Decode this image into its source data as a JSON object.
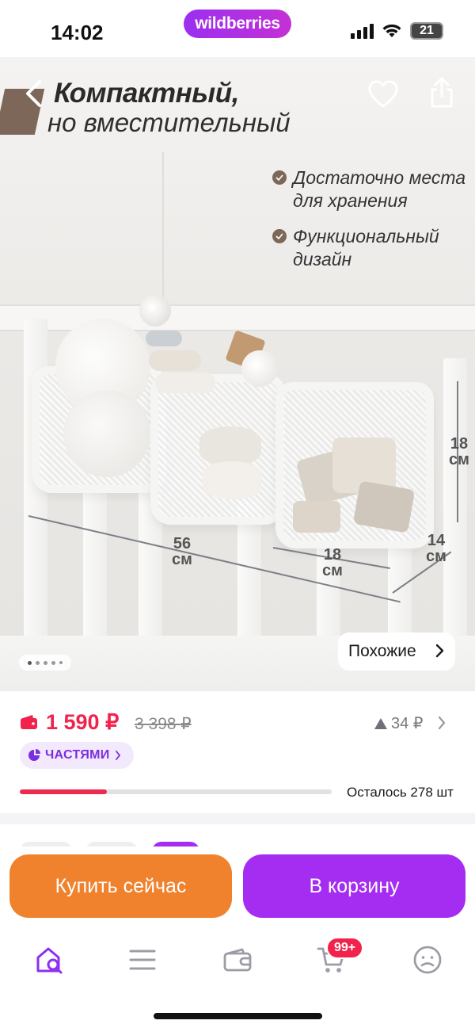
{
  "status_bar": {
    "time": "14:02",
    "brand": "wildberries",
    "battery": "21"
  },
  "gallery": {
    "headline_line1": "Компактный,",
    "headline_line2": "но вместительный",
    "features": [
      "Достаточно места\nдля хранения",
      "Функциональный\nдизайн"
    ],
    "dimensions": {
      "height_value": "18",
      "height_unit": "см",
      "width_value": "56",
      "width_unit": "см",
      "pocket_value": "18",
      "pocket_unit": "см",
      "depth_value": "14",
      "depth_unit": "см"
    },
    "similar_label": "Похожие",
    "slide_count": 5,
    "active_slide": 1
  },
  "price": {
    "current": "1 590 ₽",
    "old": "3 398 ₽",
    "change": "34 ₽",
    "installments_label": "ЧАСТЯМИ",
    "stock_label": "Осталось 278 шт",
    "stock_progress_percent": 28
  },
  "actions": {
    "buy_now": "Купить сейчас",
    "add_to_cart": "В корзину"
  },
  "tab_bar": {
    "cart_badge": "99+",
    "items": [
      "home-search-icon",
      "catalog-icon",
      "wallet-icon",
      "cart-icon",
      "profile-icon"
    ]
  },
  "colors": {
    "brand_gradient_start": "#9b2ff0",
    "brand_gradient_end": "#c431d6",
    "price_red": "#f1234d",
    "buy_orange": "#f0822d",
    "cart_purple": "#a52df2",
    "accent_brown": "#7d6759"
  }
}
